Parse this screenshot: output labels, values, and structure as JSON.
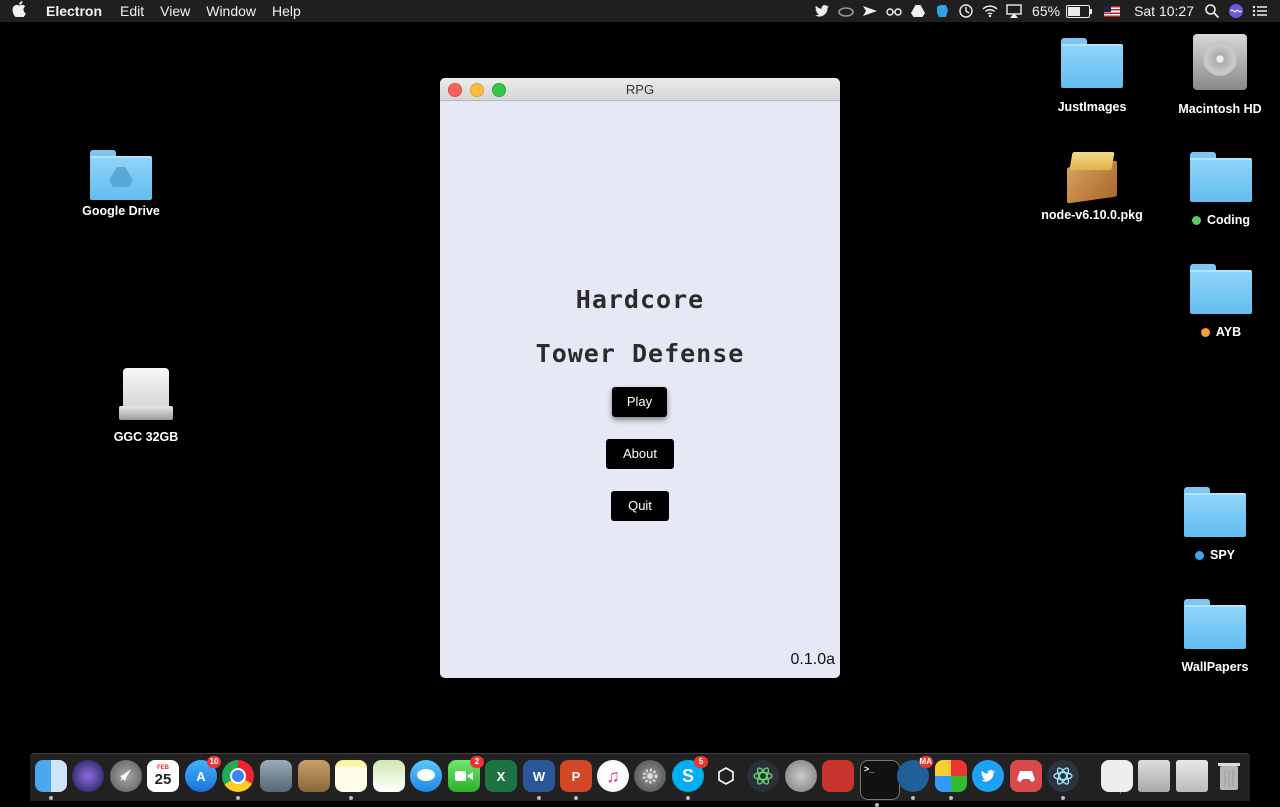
{
  "menubar": {
    "app_name": "Electron",
    "menus": [
      "Edit",
      "View",
      "Window",
      "Help"
    ],
    "battery_percent": "65%",
    "battery_level": 0.65,
    "clock": "Sat 10:27",
    "status_icons": [
      "twitter-icon",
      "creative-cloud-icon",
      "send-icon",
      "glasses-icon",
      "google-drive-icon",
      "evernote-icon",
      "time-machine-icon",
      "wifi-icon",
      "airplay-icon"
    ]
  },
  "desktop": {
    "icons": [
      {
        "label": "Google Drive"
      },
      {
        "label": "GGC 32GB"
      },
      {
        "label": "JustImages"
      },
      {
        "label": "Macintosh HD"
      },
      {
        "label": "node-v6.10.0.pkg"
      },
      {
        "label": "Coding",
        "tag_color": "#5ccb5f"
      },
      {
        "label": "AYB",
        "tag_color": "#f5a13b"
      },
      {
        "label": "SPY",
        "tag_color": "#3aa6f2"
      },
      {
        "label": "WallPapers"
      }
    ]
  },
  "window": {
    "title": "RPG",
    "game_title_line1": "Hardcore",
    "game_title_line2": "Tower Defense",
    "play_label": "Play",
    "about_label": "About",
    "quit_label": "Quit",
    "version": "0.1.0a"
  },
  "dock": {
    "calendar_month": "FEB",
    "calendar_day": "25",
    "app_store_badge": "10",
    "facetime_badge": "2",
    "skype_badge": "5",
    "mail_badge": "MA",
    "excel_letter": "X",
    "word_letter": "W",
    "powerpoint_letter": "P",
    "skype_letter": "S",
    "terminal_prompt": ">_"
  }
}
